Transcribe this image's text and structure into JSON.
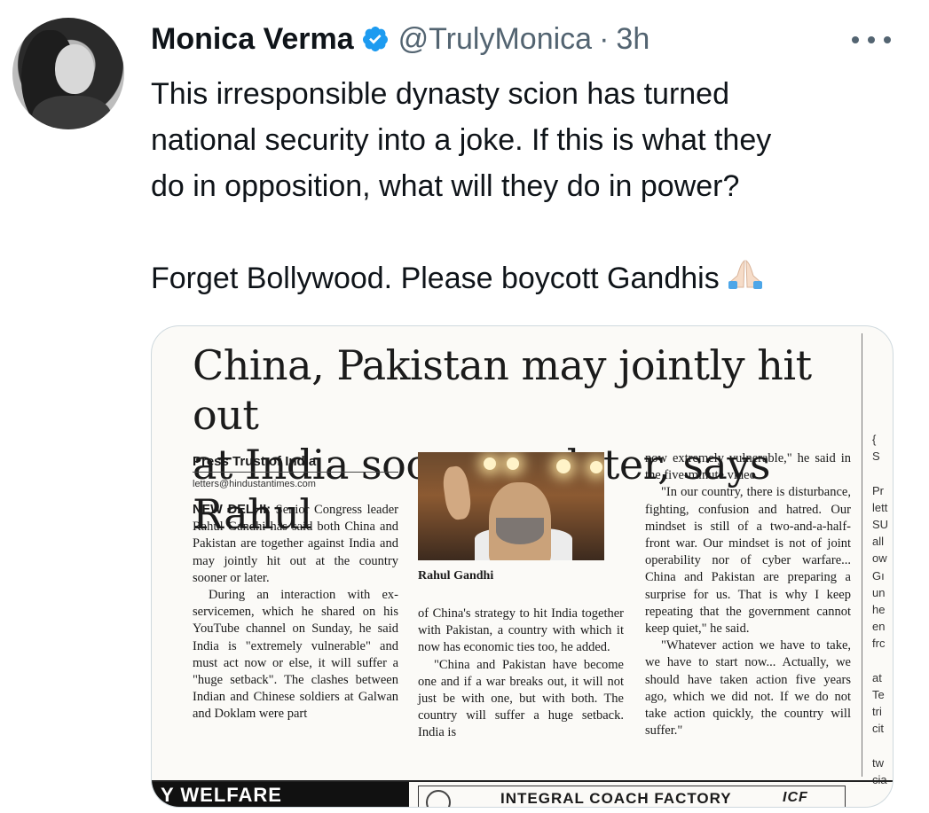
{
  "tweet": {
    "author_name": "Monica Verma",
    "handle": "@TrulyMonica",
    "separator": "·",
    "time": "3h",
    "text_lines": [
      "This irresponsible dynasty scion has turned",
      "national security into a joke. If this is what they",
      "do in opposition, what will they do in power?"
    ],
    "text_second": "Forget Bollywood. Please boycott Gandhis",
    "emoji_name": "folded-hands-emoji",
    "verified_color": "#1d9bf0"
  },
  "clipping": {
    "headline_line1": "China, Pakistan may jointly hit out",
    "headline_line2": "at India sooner or later, says Rahul",
    "byline": "Press Trust of India",
    "email": "letters@hindustantimes.com",
    "dateline": "NEW DELHI:",
    "col1_para1": "Senior Congress leader Rahul Gandhi has said both China and Pakistan are together against India and may jointly hit out at the country sooner or later.",
    "col1_para2": "During an interaction with ex-servicemen, which he shared on his YouTube channel on Sunday, he said India is \"extremely vulnerable\" and must act now or else, it will suffer a \"huge setback\". The clashes between Indian and Chinese soldiers at Galwan and Doklam were part",
    "photo_caption": "Rahul Gandhi",
    "col2_para1": "of China's strategy to hit India together with Pakistan, a country with which it now has economic ties too, he added.",
    "col2_para2": "\"China and Pakistan have become one and if a war breaks out, it will not just be with one, but with both. The country will suffer a huge setback. India is",
    "col3_para1": "now extremely vulnerable,\" he said in the five-minute video.",
    "col3_para2": "\"In our country, there is disturbance, fighting, confusion and hatred. Our mindset is still of a two-and-a-half-front war. Our mindset is not of joint operability nor of cyber warfare... China and Pakistan are preparing a surprise for us. That is why I keep repeating that the government cannot keep quiet,\" he said.",
    "col3_para3": "\"Whatever action we have to take, we have to start now... Actually, we should have taken action five years ago, which we did not. If we do not take action quickly, the country will suffer.\"",
    "edge_fragments": [
      "{",
      "S",
      "",
      "Pr",
      "lett",
      "SU",
      "all",
      "ow",
      "Gı",
      "un",
      "he",
      "en",
      "frc",
      "",
      "at",
      "Te",
      "tri",
      "cit",
      "",
      "tw",
      "cia"
    ],
    "bottom_left": "Y WELFARE",
    "bottom_center": "INTEGRAL COACH FACTORY",
    "bottom_logo": "ICF"
  }
}
